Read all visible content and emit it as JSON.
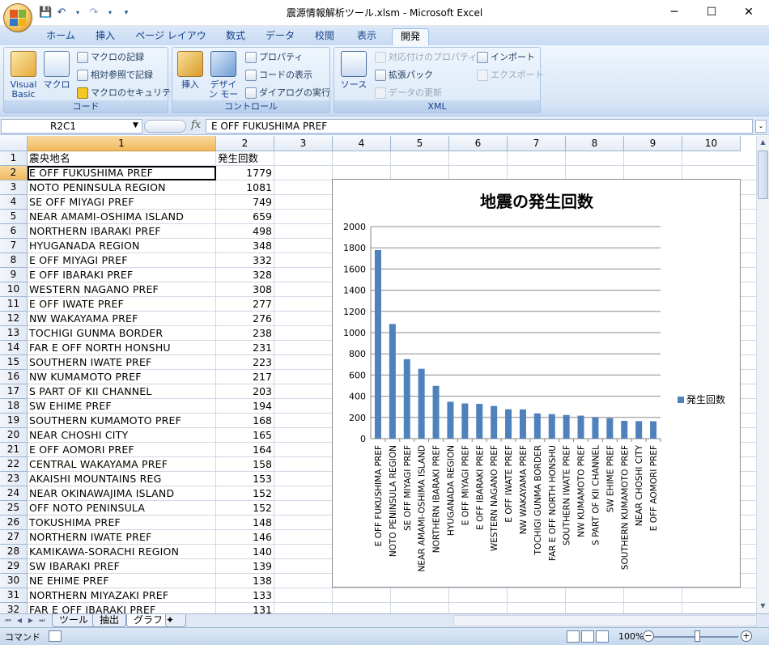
{
  "window": {
    "title": "震源情報解析ツール.xlsm - Microsoft Excel",
    "controls": [
      "─",
      "☐",
      "✕"
    ]
  },
  "ribbon": {
    "tabs": [
      "ホーム",
      "挿入",
      "ページ レイアウト",
      "数式",
      "データ",
      "校閲",
      "表示",
      "開発"
    ],
    "active_tab": "開発",
    "groups": {
      "code": {
        "label": "コード",
        "visual_basic": "Visual Basic",
        "macro": "マクロ",
        "record_macro": "マクロの記録",
        "relative_ref": "相対参照で記録",
        "macro_security": "マクロのセキュリティ"
      },
      "controls": {
        "label": "コントロール",
        "insert": "挿入",
        "design_mode": "デザイン モード",
        "properties": "プロパティ",
        "view_code": "コードの表示",
        "run_dialog": "ダイアログの実行"
      },
      "xml": {
        "label": "XML",
        "source": "ソース",
        "map_properties": "対応付けのプロパティ",
        "expansion_packs": "拡張パック",
        "refresh_data": "データの更新",
        "import": "インポート",
        "export": "エクスポート"
      }
    }
  },
  "formula_bar": {
    "name_box": "R2C1",
    "fx_label": "fx",
    "value": "E OFF FUKUSHIMA PREF"
  },
  "sheet": {
    "columns": [
      "1",
      "2",
      "3",
      "4",
      "5",
      "6",
      "7",
      "8",
      "9",
      "10"
    ],
    "header_row": {
      "num": "1",
      "name": "震央地名",
      "count": "発生回数"
    },
    "rows": [
      {
        "num": "2",
        "name": "E OFF FUKUSHIMA PREF",
        "count": "1779"
      },
      {
        "num": "3",
        "name": "NOTO PENINSULA REGION",
        "count": "1081"
      },
      {
        "num": "4",
        "name": "SE OFF MIYAGI PREF",
        "count": "749"
      },
      {
        "num": "5",
        "name": "NEAR AMAMI-OSHIMA ISLAND",
        "count": "659"
      },
      {
        "num": "6",
        "name": "NORTHERN IBARAKI PREF",
        "count": "498"
      },
      {
        "num": "7",
        "name": "HYUGANADA REGION",
        "count": "348"
      },
      {
        "num": "8",
        "name": "E OFF MIYAGI PREF",
        "count": "332"
      },
      {
        "num": "9",
        "name": "E OFF IBARAKI PREF",
        "count": "328"
      },
      {
        "num": "10",
        "name": "WESTERN NAGANO PREF",
        "count": "308"
      },
      {
        "num": "11",
        "name": "E OFF IWATE PREF",
        "count": "277"
      },
      {
        "num": "12",
        "name": "NW WAKAYAMA PREF",
        "count": "276"
      },
      {
        "num": "13",
        "name": "TOCHIGI GUNMA BORDER",
        "count": "238"
      },
      {
        "num": "14",
        "name": "FAR E OFF NORTH HONSHU",
        "count": "231"
      },
      {
        "num": "15",
        "name": "SOUTHERN IWATE PREF",
        "count": "223"
      },
      {
        "num": "16",
        "name": "NW KUMAMOTO PREF",
        "count": "217"
      },
      {
        "num": "17",
        "name": "S PART OF KII CHANNEL",
        "count": "203"
      },
      {
        "num": "18",
        "name": "SW EHIME PREF",
        "count": "194"
      },
      {
        "num": "19",
        "name": "SOUTHERN KUMAMOTO PREF",
        "count": "168"
      },
      {
        "num": "20",
        "name": "NEAR CHOSHI CITY",
        "count": "165"
      },
      {
        "num": "21",
        "name": "E OFF AOMORI PREF",
        "count": "164"
      },
      {
        "num": "22",
        "name": "CENTRAL WAKAYAMA PREF",
        "count": "158"
      },
      {
        "num": "23",
        "name": "AKAISHI MOUNTAINS REG",
        "count": "153"
      },
      {
        "num": "24",
        "name": "NEAR OKINAWAJIMA ISLAND",
        "count": "152"
      },
      {
        "num": "25",
        "name": "OFF NOTO PENINSULA",
        "count": "152"
      },
      {
        "num": "26",
        "name": "TOKUSHIMA PREF",
        "count": "148"
      },
      {
        "num": "27",
        "name": "NORTHERN IWATE PREF",
        "count": "146"
      },
      {
        "num": "28",
        "name": "KAMIKAWA-SORACHI REGION",
        "count": "140"
      },
      {
        "num": "29",
        "name": "SW IBARAKI PREF",
        "count": "139"
      },
      {
        "num": "30",
        "name": "NE EHIME PREF",
        "count": "138"
      },
      {
        "num": "31",
        "name": "NORTHERN MIYAZAKI PREF",
        "count": "133"
      },
      {
        "num": "32",
        "name": "FAR E OFF IBARAKI PREF",
        "count": "131"
      }
    ]
  },
  "sheet_tabs": {
    "tabs": [
      "ツール",
      "抽出",
      "グラフ"
    ],
    "active": "グラフ"
  },
  "status_bar": {
    "mode": "コマンド",
    "zoom": "100%"
  },
  "colors": {
    "bar": "#4f81bd",
    "ribbon_text": "#15428b",
    "selected_header": "#f1b95c"
  },
  "chart_data": {
    "type": "bar",
    "title": "地震の発生回数",
    "categories": [
      "E OFF FUKUSHIMA PREF",
      "NOTO PENINSULA REGION",
      "SE OFF MIYAGI PREF",
      "NEAR AMAMI-OSHIMA ISLAND",
      "NORTHERN IBARAKI PREF",
      "HYUGANADA REGION",
      "E OFF MIYAGI PREF",
      "E OFF IBARAKI PREF",
      "WESTERN NAGANO PREF",
      "E OFF IWATE PREF",
      "NW WAKAYAMA PREF",
      "TOCHIGI GUNMA BORDER",
      "FAR E OFF NORTH HONSHU",
      "SOUTHERN IWATE PREF",
      "NW KUMAMOTO PREF",
      "S PART OF KII CHANNEL",
      "SW EHIME PREF",
      "SOUTHERN KUMAMOTO PREF",
      "NEAR CHOSHI CITY",
      "E OFF AOMORI PREF"
    ],
    "series": [
      {
        "name": "発生回数",
        "values": [
          1779,
          1081,
          749,
          659,
          498,
          348,
          332,
          328,
          308,
          277,
          276,
          238,
          231,
          223,
          217,
          203,
          194,
          168,
          165,
          164
        ]
      }
    ],
    "yticks": [
      "0",
      "200",
      "400",
      "600",
      "800",
      "1000",
      "1200",
      "1400",
      "1600",
      "1800",
      "2000"
    ],
    "ylim": [
      0,
      2000
    ],
    "grid": true,
    "legend": "right"
  }
}
